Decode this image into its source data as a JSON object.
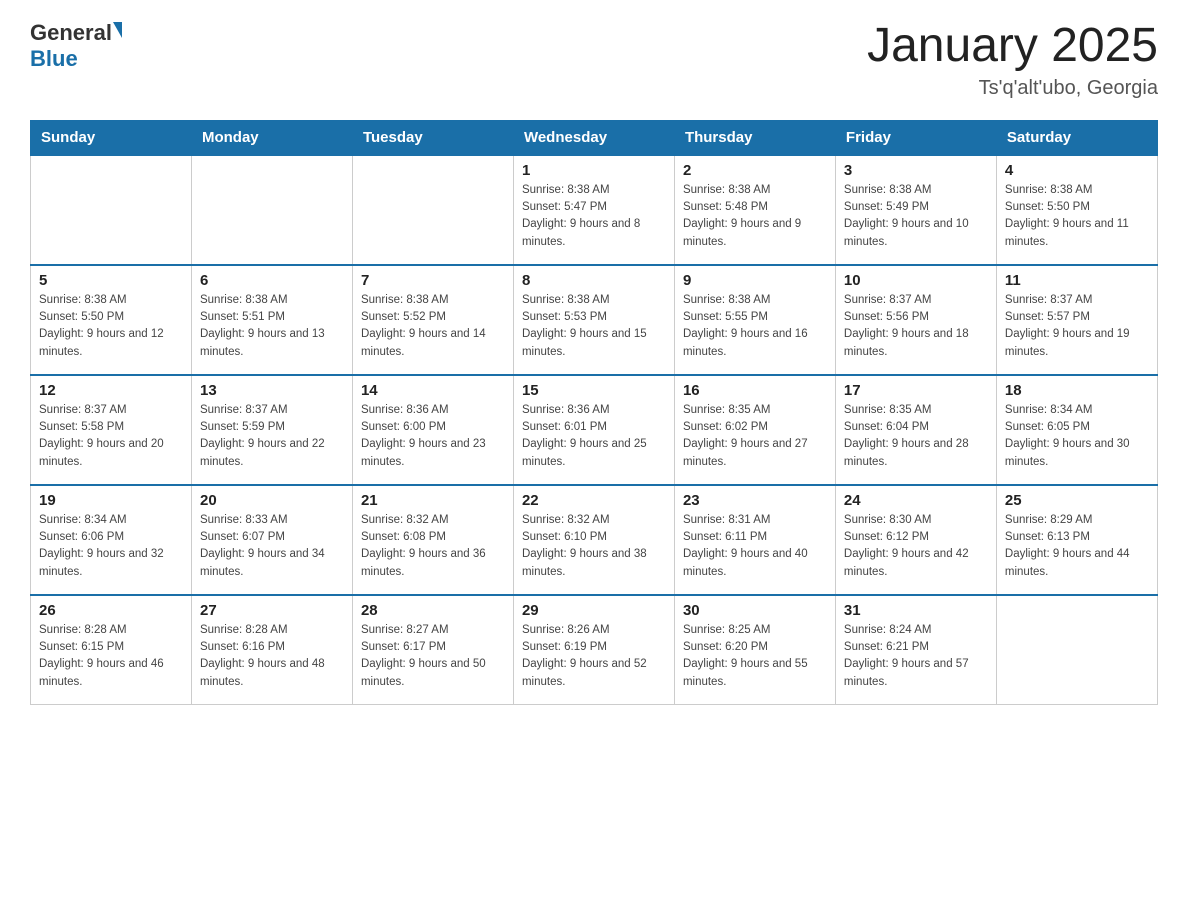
{
  "header": {
    "logo": {
      "general": "General",
      "blue": "Blue"
    },
    "title": "January 2025",
    "subtitle": "Ts'q'alt'ubo, Georgia"
  },
  "days_of_week": [
    "Sunday",
    "Monday",
    "Tuesday",
    "Wednesday",
    "Thursday",
    "Friday",
    "Saturday"
  ],
  "weeks": [
    [
      {
        "day": "",
        "sunrise": "",
        "sunset": "",
        "daylight": ""
      },
      {
        "day": "",
        "sunrise": "",
        "sunset": "",
        "daylight": ""
      },
      {
        "day": "",
        "sunrise": "",
        "sunset": "",
        "daylight": ""
      },
      {
        "day": "1",
        "sunrise": "Sunrise: 8:38 AM",
        "sunset": "Sunset: 5:47 PM",
        "daylight": "Daylight: 9 hours and 8 minutes."
      },
      {
        "day": "2",
        "sunrise": "Sunrise: 8:38 AM",
        "sunset": "Sunset: 5:48 PM",
        "daylight": "Daylight: 9 hours and 9 minutes."
      },
      {
        "day": "3",
        "sunrise": "Sunrise: 8:38 AM",
        "sunset": "Sunset: 5:49 PM",
        "daylight": "Daylight: 9 hours and 10 minutes."
      },
      {
        "day": "4",
        "sunrise": "Sunrise: 8:38 AM",
        "sunset": "Sunset: 5:50 PM",
        "daylight": "Daylight: 9 hours and 11 minutes."
      }
    ],
    [
      {
        "day": "5",
        "sunrise": "Sunrise: 8:38 AM",
        "sunset": "Sunset: 5:50 PM",
        "daylight": "Daylight: 9 hours and 12 minutes."
      },
      {
        "day": "6",
        "sunrise": "Sunrise: 8:38 AM",
        "sunset": "Sunset: 5:51 PM",
        "daylight": "Daylight: 9 hours and 13 minutes."
      },
      {
        "day": "7",
        "sunrise": "Sunrise: 8:38 AM",
        "sunset": "Sunset: 5:52 PM",
        "daylight": "Daylight: 9 hours and 14 minutes."
      },
      {
        "day": "8",
        "sunrise": "Sunrise: 8:38 AM",
        "sunset": "Sunset: 5:53 PM",
        "daylight": "Daylight: 9 hours and 15 minutes."
      },
      {
        "day": "9",
        "sunrise": "Sunrise: 8:38 AM",
        "sunset": "Sunset: 5:55 PM",
        "daylight": "Daylight: 9 hours and 16 minutes."
      },
      {
        "day": "10",
        "sunrise": "Sunrise: 8:37 AM",
        "sunset": "Sunset: 5:56 PM",
        "daylight": "Daylight: 9 hours and 18 minutes."
      },
      {
        "day": "11",
        "sunrise": "Sunrise: 8:37 AM",
        "sunset": "Sunset: 5:57 PM",
        "daylight": "Daylight: 9 hours and 19 minutes."
      }
    ],
    [
      {
        "day": "12",
        "sunrise": "Sunrise: 8:37 AM",
        "sunset": "Sunset: 5:58 PM",
        "daylight": "Daylight: 9 hours and 20 minutes."
      },
      {
        "day": "13",
        "sunrise": "Sunrise: 8:37 AM",
        "sunset": "Sunset: 5:59 PM",
        "daylight": "Daylight: 9 hours and 22 minutes."
      },
      {
        "day": "14",
        "sunrise": "Sunrise: 8:36 AM",
        "sunset": "Sunset: 6:00 PM",
        "daylight": "Daylight: 9 hours and 23 minutes."
      },
      {
        "day": "15",
        "sunrise": "Sunrise: 8:36 AM",
        "sunset": "Sunset: 6:01 PM",
        "daylight": "Daylight: 9 hours and 25 minutes."
      },
      {
        "day": "16",
        "sunrise": "Sunrise: 8:35 AM",
        "sunset": "Sunset: 6:02 PM",
        "daylight": "Daylight: 9 hours and 27 minutes."
      },
      {
        "day": "17",
        "sunrise": "Sunrise: 8:35 AM",
        "sunset": "Sunset: 6:04 PM",
        "daylight": "Daylight: 9 hours and 28 minutes."
      },
      {
        "day": "18",
        "sunrise": "Sunrise: 8:34 AM",
        "sunset": "Sunset: 6:05 PM",
        "daylight": "Daylight: 9 hours and 30 minutes."
      }
    ],
    [
      {
        "day": "19",
        "sunrise": "Sunrise: 8:34 AM",
        "sunset": "Sunset: 6:06 PM",
        "daylight": "Daylight: 9 hours and 32 minutes."
      },
      {
        "day": "20",
        "sunrise": "Sunrise: 8:33 AM",
        "sunset": "Sunset: 6:07 PM",
        "daylight": "Daylight: 9 hours and 34 minutes."
      },
      {
        "day": "21",
        "sunrise": "Sunrise: 8:32 AM",
        "sunset": "Sunset: 6:08 PM",
        "daylight": "Daylight: 9 hours and 36 minutes."
      },
      {
        "day": "22",
        "sunrise": "Sunrise: 8:32 AM",
        "sunset": "Sunset: 6:10 PM",
        "daylight": "Daylight: 9 hours and 38 minutes."
      },
      {
        "day": "23",
        "sunrise": "Sunrise: 8:31 AM",
        "sunset": "Sunset: 6:11 PM",
        "daylight": "Daylight: 9 hours and 40 minutes."
      },
      {
        "day": "24",
        "sunrise": "Sunrise: 8:30 AM",
        "sunset": "Sunset: 6:12 PM",
        "daylight": "Daylight: 9 hours and 42 minutes."
      },
      {
        "day": "25",
        "sunrise": "Sunrise: 8:29 AM",
        "sunset": "Sunset: 6:13 PM",
        "daylight": "Daylight: 9 hours and 44 minutes."
      }
    ],
    [
      {
        "day": "26",
        "sunrise": "Sunrise: 8:28 AM",
        "sunset": "Sunset: 6:15 PM",
        "daylight": "Daylight: 9 hours and 46 minutes."
      },
      {
        "day": "27",
        "sunrise": "Sunrise: 8:28 AM",
        "sunset": "Sunset: 6:16 PM",
        "daylight": "Daylight: 9 hours and 48 minutes."
      },
      {
        "day": "28",
        "sunrise": "Sunrise: 8:27 AM",
        "sunset": "Sunset: 6:17 PM",
        "daylight": "Daylight: 9 hours and 50 minutes."
      },
      {
        "day": "29",
        "sunrise": "Sunrise: 8:26 AM",
        "sunset": "Sunset: 6:19 PM",
        "daylight": "Daylight: 9 hours and 52 minutes."
      },
      {
        "day": "30",
        "sunrise": "Sunrise: 8:25 AM",
        "sunset": "Sunset: 6:20 PM",
        "daylight": "Daylight: 9 hours and 55 minutes."
      },
      {
        "day": "31",
        "sunrise": "Sunrise: 8:24 AM",
        "sunset": "Sunset: 6:21 PM",
        "daylight": "Daylight: 9 hours and 57 minutes."
      },
      {
        "day": "",
        "sunrise": "",
        "sunset": "",
        "daylight": ""
      }
    ]
  ]
}
